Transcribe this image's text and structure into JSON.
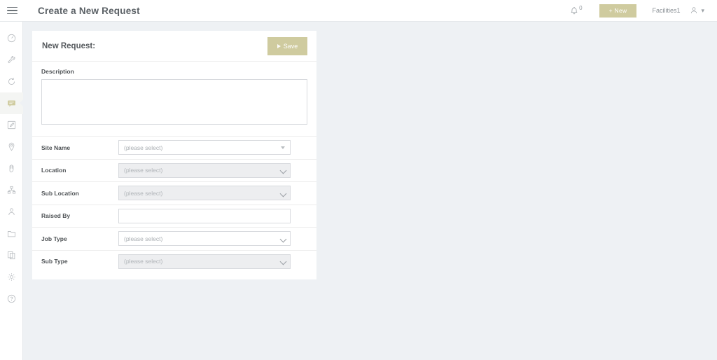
{
  "topbar": {
    "menu_icon": "hamburger-icon",
    "title": "Create a New Request",
    "bell_icon": "bell-icon",
    "bell_count": "0",
    "new_button": "+ New",
    "user_name": "Facilities1",
    "user_icon": "user-icon",
    "user_chevron": "chevron-down-icon"
  },
  "sidebar": {
    "items": [
      {
        "name": "sidebar-item-dashboard",
        "icon": "gauge-icon",
        "active": false
      },
      {
        "name": "sidebar-item-maintenance",
        "icon": "wrench-icon",
        "active": false
      },
      {
        "name": "sidebar-item-reactive",
        "icon": "refresh-icon",
        "active": false
      },
      {
        "name": "sidebar-item-requests",
        "icon": "speech-bubble-icon",
        "active": true
      },
      {
        "name": "sidebar-item-tasks",
        "icon": "edit-note-icon",
        "active": false
      },
      {
        "name": "sidebar-item-sites",
        "icon": "map-pin-icon",
        "active": false
      },
      {
        "name": "sidebar-item-assets",
        "icon": "hand-icon",
        "active": false
      },
      {
        "name": "sidebar-item-hierarchy",
        "icon": "sitemap-icon",
        "active": false
      },
      {
        "name": "sidebar-item-contacts",
        "icon": "person-icon",
        "active": false
      },
      {
        "name": "sidebar-item-folders",
        "icon": "folder-icon",
        "active": false
      },
      {
        "name": "sidebar-item-documents",
        "icon": "documents-icon",
        "active": false
      },
      {
        "name": "sidebar-item-settings",
        "icon": "gear-icon",
        "active": false
      },
      {
        "name": "sidebar-item-help",
        "icon": "help-circle-icon",
        "active": false
      }
    ]
  },
  "card": {
    "title": "New Request:",
    "save_label": "Save",
    "save_icon": "play-triangle-icon",
    "description": {
      "label": "Description",
      "value": "",
      "placeholder": ""
    },
    "fields": [
      {
        "label": "Site Name",
        "value": "(please select)",
        "type": "select",
        "disabled": false,
        "caret": "triangle"
      },
      {
        "label": "Location",
        "value": "(please select)",
        "type": "select",
        "disabled": true,
        "caret": "chevron"
      },
      {
        "label": "Sub Location",
        "value": "(please select)",
        "type": "select",
        "disabled": true,
        "caret": "chevron"
      },
      {
        "label": "Raised By",
        "value": "",
        "type": "text",
        "disabled": false,
        "caret": "none"
      },
      {
        "label": "Job Type",
        "value": "(please select)",
        "type": "select",
        "disabled": false,
        "caret": "chevron"
      },
      {
        "label": "Sub Type",
        "value": "(please select)",
        "type": "select",
        "disabled": true,
        "caret": "chevron"
      }
    ]
  },
  "colors": {
    "accent": "#cfcb9f",
    "page_background": "#eef1f4",
    "card_background": "#ffffff",
    "disabled_field": "#edeef0",
    "text": "#55595d"
  }
}
